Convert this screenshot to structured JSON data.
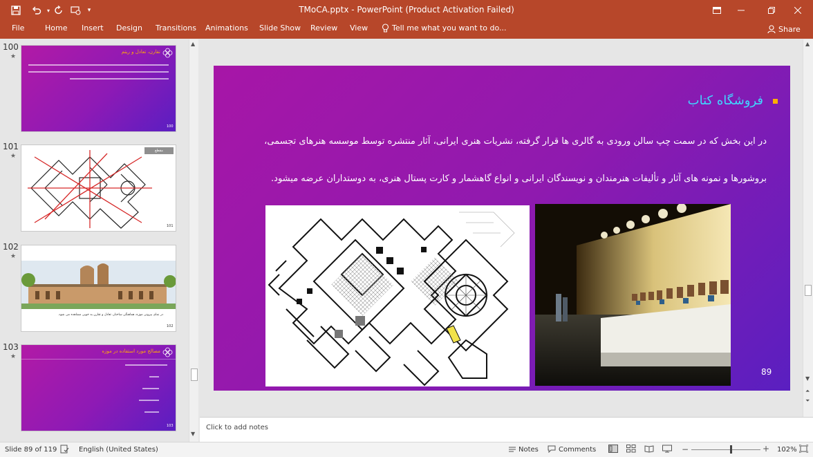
{
  "window": {
    "title": "TMoCA.pptx - PowerPoint (Product Activation Failed)"
  },
  "ribbon": {
    "tabs": [
      "File",
      "Home",
      "Insert",
      "Design",
      "Transitions",
      "Animations",
      "Slide Show",
      "Review",
      "View"
    ],
    "tell_me": "Tell me what you want to do...",
    "share": "Share"
  },
  "thumbnails": [
    {
      "number": "100",
      "title": "تقارن، تعادل و ریتم",
      "page": "100"
    },
    {
      "number": "101",
      "label": "مقطع",
      "page": "101"
    },
    {
      "number": "102",
      "caption": "در نمای بیرونی موزه، هماهنگی ساختار، تعادل و تقارن به خوبی مشاهده می شود.",
      "page": "102"
    },
    {
      "number": "103",
      "title": "مصالح مورد استفاده در موزه",
      "page": "103"
    }
  ],
  "slide": {
    "title": "فروشگاه کتاب",
    "paragraph_1": "در این بخش که در سمت چپ سالن ورودی به گالری ها قرار گرفته، نشریات هنری ایرانی، آثار منتشره توسط موسسه هنرهای تجسمی،",
    "paragraph_2": "بروشورها و نمونه های آثار و تألیفات هنرمندان و نویسندگان ایرانی و انواع گاهشمار و کارت پستال هنری، به دوستداران عرضه میشود.",
    "page_number": "89"
  },
  "notes": {
    "placeholder": "Click to add notes"
  },
  "statusbar": {
    "slide_info": "Slide 89 of 119",
    "language": "English (United States)",
    "notes_label": "Notes",
    "comments_label": "Comments",
    "zoom": "102%"
  },
  "colors": {
    "accent": "#b7472a",
    "slide_title": "#40d8ff",
    "bullet": "#ffb000"
  }
}
